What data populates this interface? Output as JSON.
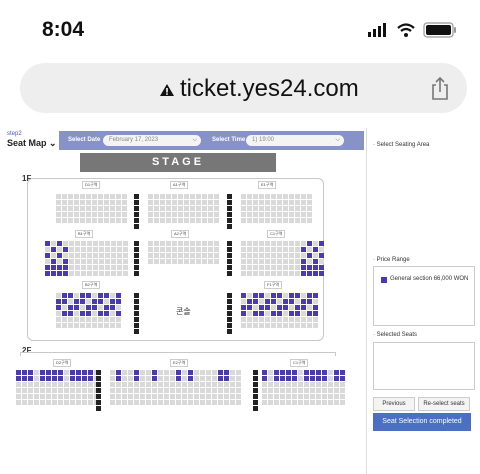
{
  "status_bar": {
    "time": "8:04"
  },
  "browser": {
    "url": "ticket.yes24.com"
  },
  "header": {
    "step": "step2",
    "title": "Seat Map",
    "select_date_label": "Select Date",
    "select_date_value": "February 17, 2023",
    "select_time_label": "Select Time",
    "select_time_value": "1) 19:00"
  },
  "stage_label": "STAGE",
  "floors": {
    "f1": "1F",
    "f2": "2F"
  },
  "sections": {
    "d1": "D1구역",
    "a1": "A1구역",
    "e1": "E1구역",
    "b1": "B1구역",
    "c1": "C1구역",
    "a2": "A2구역",
    "f1": "F1구역",
    "b2": "B2구역",
    "d2": "D2구역",
    "e2": "E2구역",
    "mixer": "콘솔"
  },
  "panel": {
    "select_area_label": "· Select Seating Area",
    "price_range_label": "· Price Range",
    "price_entry": "General section 66,000 WON",
    "selected_seats_label": "· Selected Seats",
    "previous_label": "Previous",
    "reselect_label": "Re-select seats",
    "complete_label": "Seat Selection completed"
  },
  "colors": {
    "available": "#4a3bb5",
    "unavailable": "#d9d9d9",
    "accent": "#4a6fc4"
  }
}
